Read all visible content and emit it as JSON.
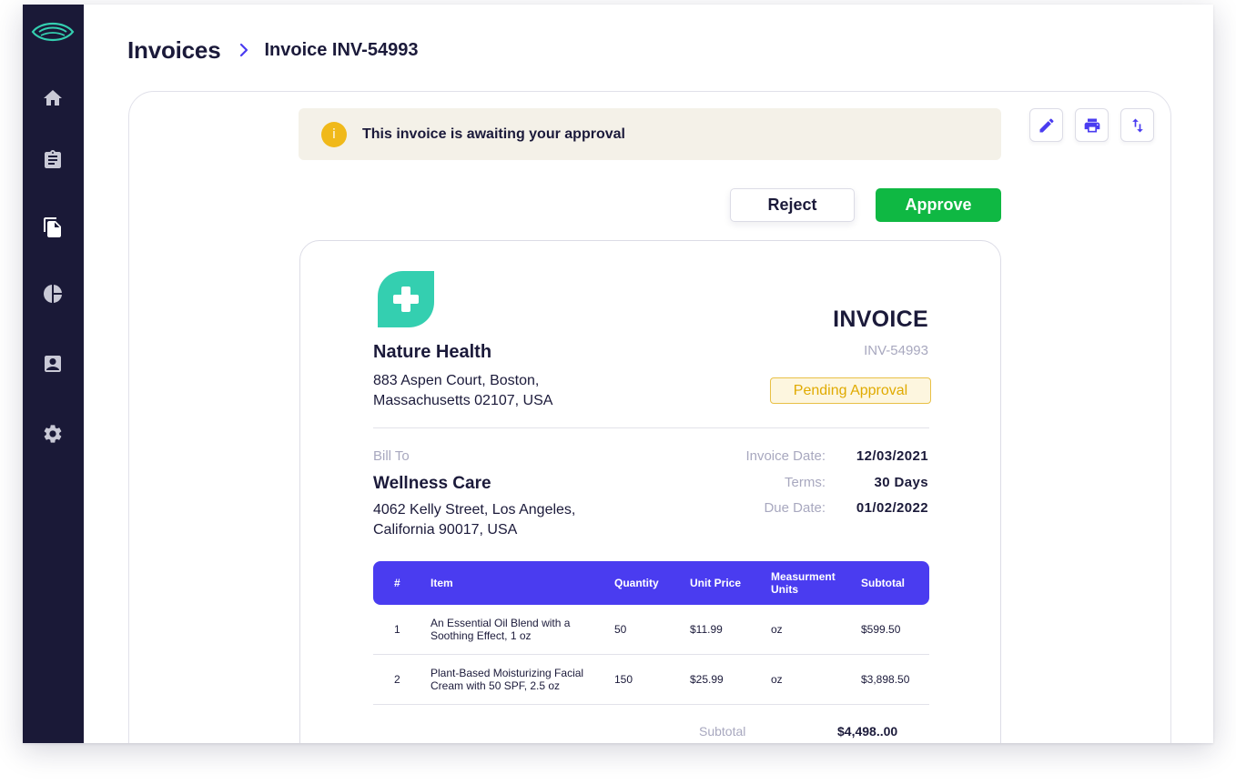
{
  "breadcrumb": {
    "root": "Invoices",
    "current": "Invoice INV-54993"
  },
  "sidebar": {
    "items": [
      {
        "name": "home",
        "icon": "home-icon"
      },
      {
        "name": "clipboard",
        "icon": "clipboard-icon"
      },
      {
        "name": "documents",
        "icon": "documents-icon",
        "active": true
      },
      {
        "name": "reports",
        "icon": "pie-chart-icon"
      },
      {
        "name": "contacts",
        "icon": "contact-card-icon"
      },
      {
        "name": "settings",
        "icon": "gear-icon"
      }
    ]
  },
  "alert": {
    "icon_glyph": "i",
    "text": "This invoice is awaiting your approval"
  },
  "toolbar": {
    "icons": [
      "edit-icon",
      "print-icon",
      "sort-icon"
    ]
  },
  "actions": {
    "reject_label": "Reject",
    "approve_label": "Approve"
  },
  "invoice": {
    "company": {
      "name": "Nature Health",
      "address_line1": "883 Aspen Court, Boston,",
      "address_line2": "Massachusetts 02107, USA"
    },
    "title": "INVOICE",
    "number": "INV-54993",
    "status": "Pending Approval",
    "bill_to": {
      "label": "Bill To",
      "name": "Wellness Care",
      "address_line1": "4062 Kelly Street, Los Angeles,",
      "address_line2": "California 90017, USA"
    },
    "meta": [
      {
        "label": "Invoice Date:",
        "value": "12/03/2021"
      },
      {
        "label": "Terms:",
        "value": "30 Days"
      },
      {
        "label": "Due Date:",
        "value": "01/02/2022"
      }
    ],
    "table": {
      "headers": [
        "#",
        "Item",
        "Quantity",
        "Unit Price",
        "Measurment Units",
        "Subtotal"
      ],
      "rows": [
        {
          "num": "1",
          "item": "An Essential Oil Blend with a Soothing Effect, 1 oz",
          "qty": "50",
          "price": "$11.99",
          "unit": "oz",
          "subtotal": "$599.50"
        },
        {
          "num": "2",
          "item": "Plant-Based Moisturizing Facial Cream with 50 SPF, 2.5 oz",
          "qty": "150",
          "price": "$25.99",
          "unit": "oz",
          "subtotal": "$3,898.50"
        }
      ]
    },
    "totals": {
      "subtotal_label": "Subtotal",
      "subtotal_value": "$4,498..00"
    }
  },
  "colors": {
    "sidebar": "#1a1937",
    "accent": "#4a3cf0",
    "approve": "#0fb843",
    "warning": "#f0b91a",
    "logo_teal": "#34cfb0"
  }
}
